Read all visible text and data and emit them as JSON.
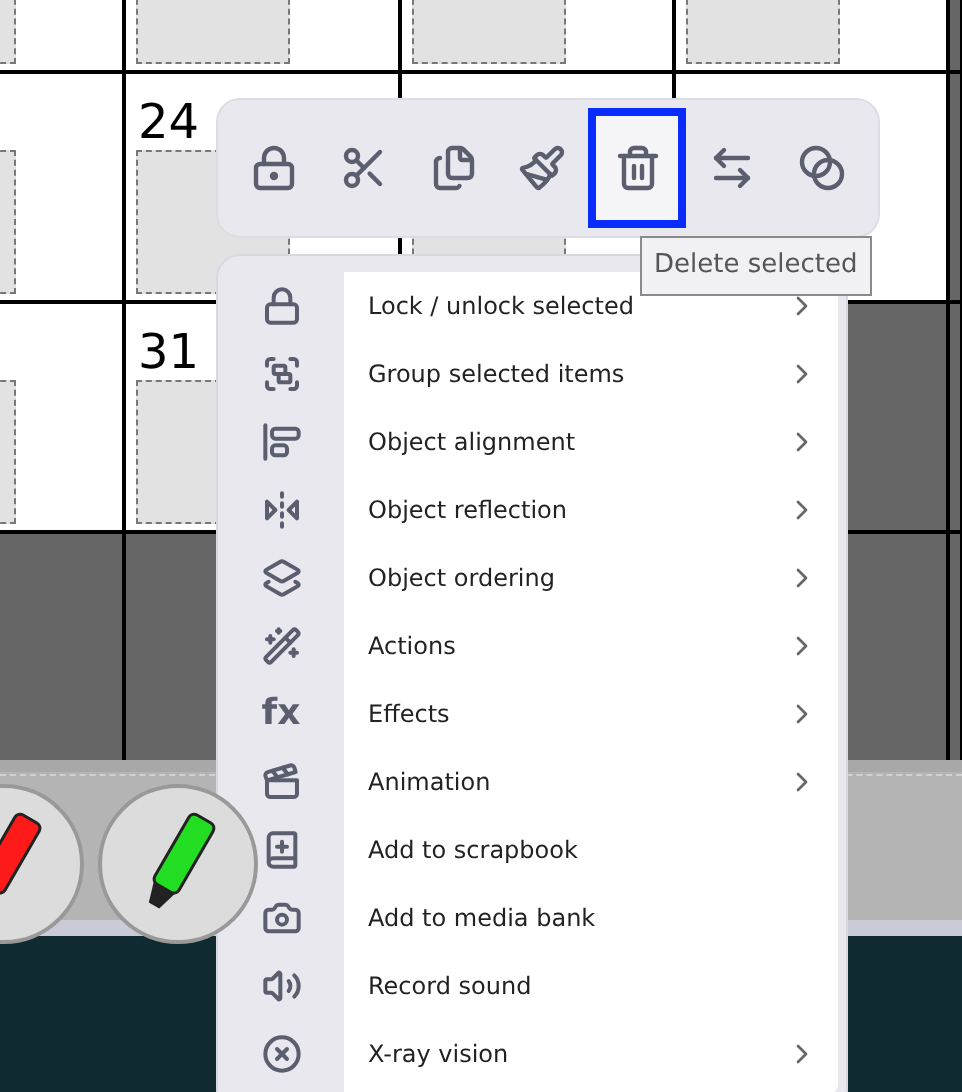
{
  "calendar": {
    "rows": [
      {
        "cells": [
          {
            "in_month": true
          },
          {
            "in_month": true
          },
          {
            "in_month": true
          },
          {
            "in_month": true
          },
          {
            "in_month": false
          }
        ]
      },
      {
        "cells": [
          {
            "in_month": true
          },
          {
            "in_month": true,
            "day": "24"
          },
          {
            "in_month": true
          },
          {
            "in_month": true,
            "box": false
          },
          {
            "in_month": false
          }
        ]
      },
      {
        "cells": [
          {
            "in_month": true
          },
          {
            "in_month": true,
            "day": "31"
          },
          {},
          {
            "in_month": false
          },
          {
            "in_month": false
          }
        ]
      },
      {
        "cells": [
          {
            "in_month": false
          },
          {
            "in_month": false
          },
          {},
          {
            "in_month": false
          },
          {
            "in_month": false
          }
        ]
      }
    ]
  },
  "pens": [
    {
      "kind": "marker",
      "color": "#ff1a1a"
    },
    {
      "kind": "highlighter",
      "color": "#22dd22"
    }
  ],
  "toolbar": {
    "buttons": [
      {
        "selected": false
      },
      {
        "selected": false
      },
      {
        "selected": false
      },
      {
        "selected": false
      },
      {
        "selected": true
      },
      {
        "selected": false
      },
      {
        "selected": false
      }
    ],
    "tooltip": "Delete selected"
  },
  "menu": {
    "items": [
      {
        "label": "Lock / unlock selected",
        "submenu": true
      },
      {
        "label": "Group selected items",
        "submenu": true
      },
      {
        "label": "Object alignment",
        "submenu": true
      },
      {
        "label": "Object reflection",
        "submenu": true
      },
      {
        "label": "Object ordering",
        "submenu": true
      },
      {
        "label": "Actions",
        "submenu": true
      },
      {
        "label": "Effects",
        "submenu": true,
        "icon_text": "fx"
      },
      {
        "label": "Animation",
        "submenu": true
      },
      {
        "label": "Add to scrapbook",
        "submenu": false
      },
      {
        "label": "Add to media bank",
        "submenu": false
      },
      {
        "label": "Record sound",
        "submenu": false
      },
      {
        "label": "X-ray vision",
        "submenu": true
      }
    ]
  }
}
